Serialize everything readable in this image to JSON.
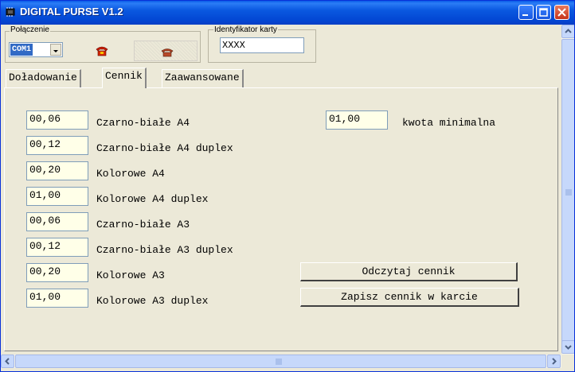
{
  "window": {
    "title": "DIGITAL PURSE V1.2"
  },
  "connection": {
    "group_label": "Połączenie",
    "port_value": "COM1"
  },
  "card": {
    "group_label": "Identyfikator karty",
    "id_value": "XXXX"
  },
  "tabs": [
    {
      "label": "Doładowanie",
      "active": false
    },
    {
      "label": "Cennik",
      "active": true
    },
    {
      "label": "Zaawansowane",
      "active": false
    }
  ],
  "prices": [
    {
      "value": "00,06",
      "label": "Czarno-białe A4"
    },
    {
      "value": "00,12",
      "label": "Czarno-białe A4 duplex"
    },
    {
      "value": "00,20",
      "label": "Kolorowe A4"
    },
    {
      "value": "01,00",
      "label": "Kolorowe A4 duplex"
    },
    {
      "value": "00,06",
      "label": "Czarno-białe A3"
    },
    {
      "value": "00,12",
      "label": "Czarno-białe A3 duplex"
    },
    {
      "value": "00,20",
      "label": "Kolorowe A3"
    },
    {
      "value": "01,00",
      "label": "Kolorowe A3 duplex"
    }
  ],
  "minimum": {
    "value": "01,00",
    "label": "kwota minimalna"
  },
  "buttons": {
    "read": "Odczytaj cennik",
    "write": "Zapisz cennik w karcie"
  },
  "icons": {
    "app": "chip-icon",
    "phone": "phone-icon",
    "minimize": "minimize-icon",
    "maximize": "maximize-icon",
    "close": "close-icon"
  },
  "colors": {
    "titlebar": "#0a58e0",
    "field_bg": "#ffffe8",
    "dialog_bg": "#ece9d8"
  }
}
